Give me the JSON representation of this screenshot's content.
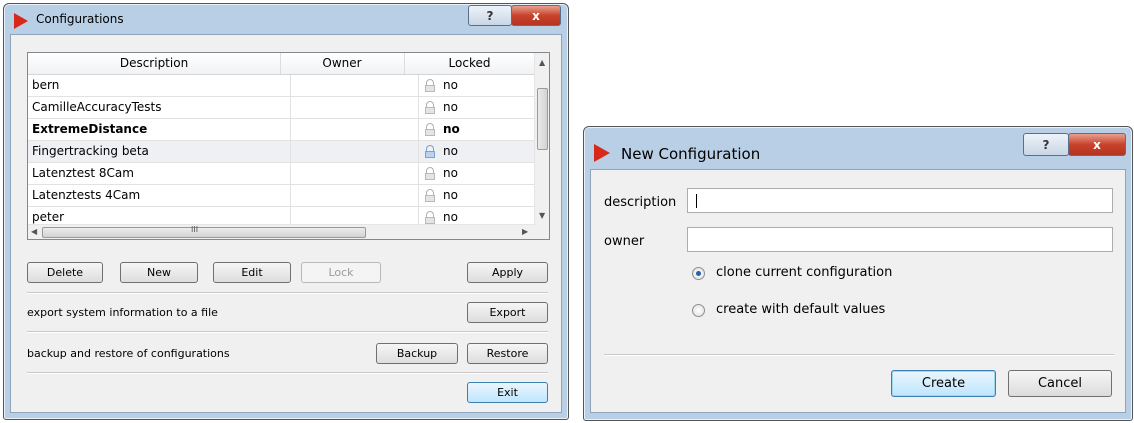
{
  "configurations_window": {
    "title": "Configurations",
    "help_button": "?",
    "close_button": "x",
    "table": {
      "columns": [
        "Description",
        "Owner",
        "Locked"
      ],
      "rows": [
        {
          "description": "bern",
          "owner": "",
          "locked": "no",
          "bold": false,
          "selected": false
        },
        {
          "description": "CamilleAccuracyTests",
          "owner": "",
          "locked": "no",
          "bold": false,
          "selected": false
        },
        {
          "description": "ExtremeDistance",
          "owner": "",
          "locked": "no",
          "bold": true,
          "selected": false
        },
        {
          "description": "Fingertracking beta",
          "owner": "",
          "locked": "no",
          "bold": false,
          "selected": true
        },
        {
          "description": "Latenztest 8Cam",
          "owner": "",
          "locked": "no",
          "bold": false,
          "selected": false
        },
        {
          "description": "Latenztests 4Cam",
          "owner": "",
          "locked": "no",
          "bold": false,
          "selected": false
        },
        {
          "description": "peter",
          "owner": "",
          "locked": "no",
          "bold": false,
          "selected": false
        }
      ],
      "hscroll_grip": "III"
    },
    "buttons": {
      "delete": "Delete",
      "new": "New",
      "edit": "Edit",
      "lock": "Lock",
      "apply": "Apply",
      "export": "Export",
      "backup": "Backup",
      "restore": "Restore",
      "exit": "Exit"
    },
    "export_label": "export system information to a file",
    "backup_label": "backup and restore of configurations"
  },
  "new_configuration_dialog": {
    "title": "New Configuration",
    "help_button": "?",
    "close_button": "x",
    "description_label": "description",
    "description_value": "",
    "owner_label": "owner",
    "owner_value": "",
    "radio_options": [
      {
        "label": "clone current configuration",
        "selected": true
      },
      {
        "label": "create with default values",
        "selected": false
      }
    ],
    "create_button": "Create",
    "cancel_button": "Cancel"
  },
  "colors": {
    "title_bar": "#b9cfe6",
    "close_button": "#c7432c",
    "app_icon": "#d8281a",
    "default_button": "#bee6fd"
  }
}
